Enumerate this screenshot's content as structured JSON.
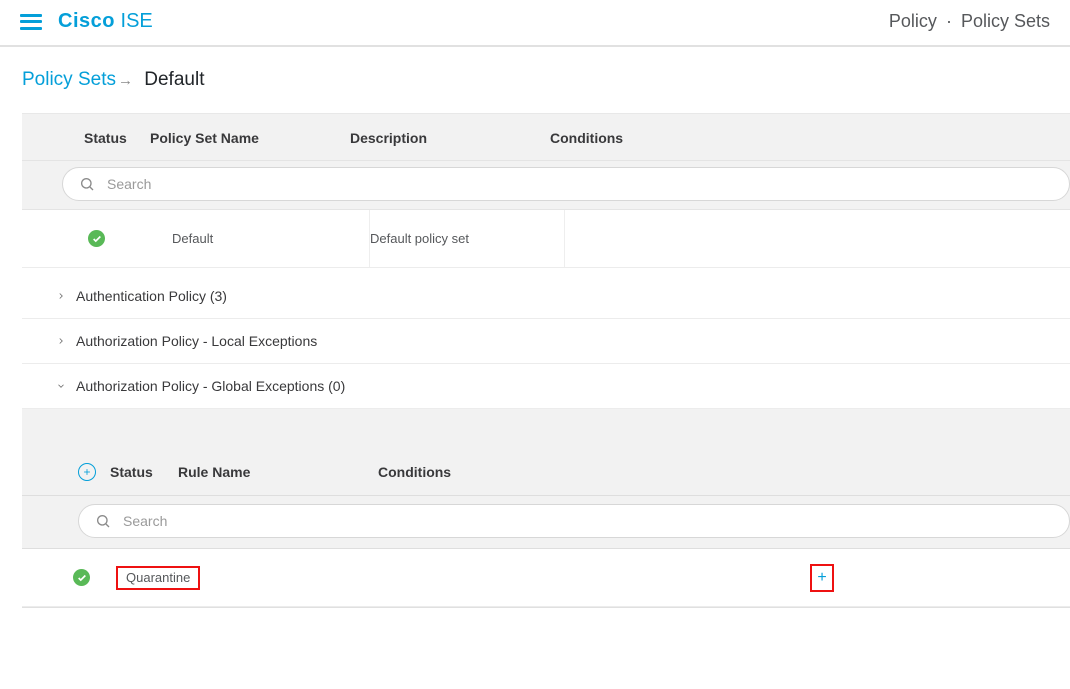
{
  "header": {
    "brand_strong": "Cisco",
    "brand_light": "ISE",
    "crumb_top_1": "Policy",
    "crumb_top_2": "Policy Sets"
  },
  "breadcrumb": {
    "link": "Policy Sets",
    "current": "Default"
  },
  "policy_table": {
    "headers": {
      "status": "Status",
      "name": "Policy Set Name",
      "description": "Description",
      "conditions": "Conditions"
    },
    "search_placeholder": "Search",
    "row": {
      "name": "Default",
      "description": "Default policy set"
    }
  },
  "sections": {
    "auth_policy": "Authentication Policy (3)",
    "authz_local": "Authorization Policy - Local Exceptions",
    "authz_global": "Authorization Policy - Global Exceptions (0)"
  },
  "sub_panel": {
    "headers": {
      "status": "Status",
      "rule_name": "Rule Name",
      "conditions": "Conditions"
    },
    "search_placeholder": "Search",
    "row": {
      "rule_name": "Quarantine"
    }
  }
}
